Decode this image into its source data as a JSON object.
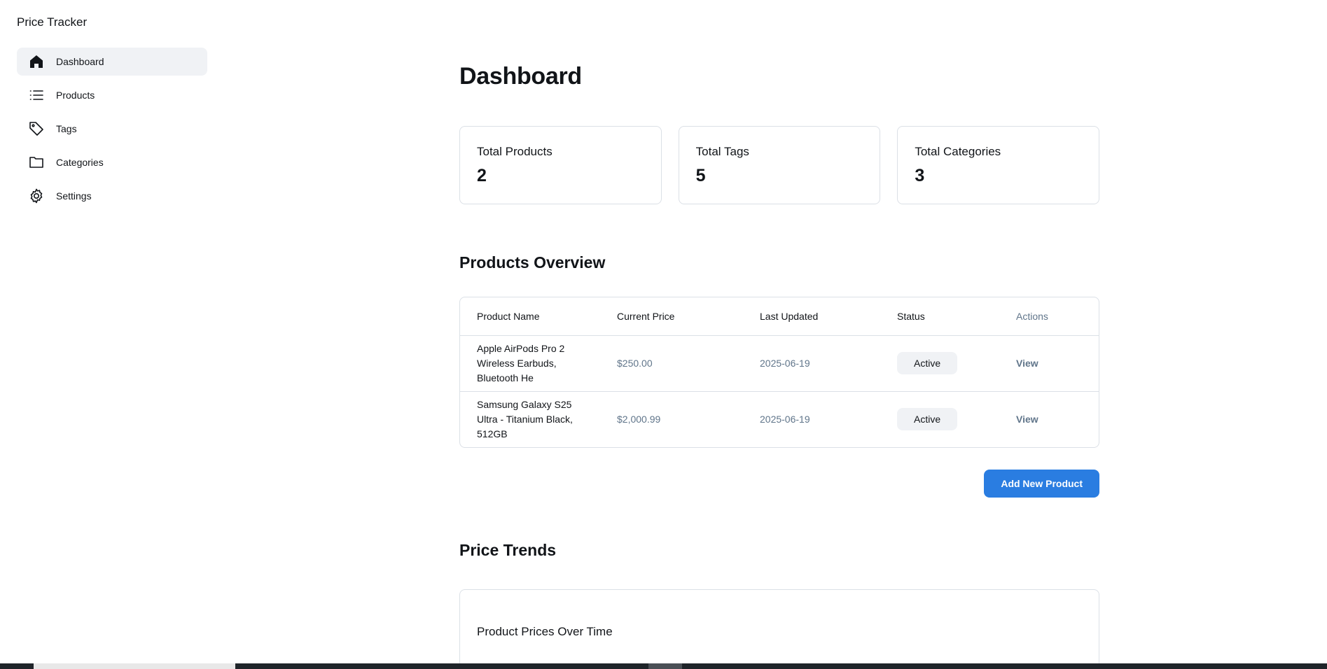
{
  "app": {
    "title": "Price Tracker"
  },
  "sidebar": {
    "items": [
      {
        "label": "Dashboard",
        "icon": "house-icon",
        "active": true
      },
      {
        "label": "Products",
        "icon": "list-icon",
        "active": false
      },
      {
        "label": "Tags",
        "icon": "tag-icon",
        "active": false
      },
      {
        "label": "Categories",
        "icon": "folder-icon",
        "active": false
      },
      {
        "label": "Settings",
        "icon": "gear-icon",
        "active": false
      }
    ]
  },
  "main": {
    "title": "Dashboard",
    "stats": [
      {
        "label": "Total Products",
        "value": "2"
      },
      {
        "label": "Total Tags",
        "value": "5"
      },
      {
        "label": "Total Categories",
        "value": "3"
      }
    ],
    "products_overview": {
      "title": "Products Overview",
      "columns": [
        "Product Name",
        "Current Price",
        "Last Updated",
        "Status",
        "Actions"
      ],
      "rows": [
        {
          "name": "Apple AirPods Pro 2 Wireless Earbuds, Bluetooth He",
          "price": "$250.00",
          "updated": "2025-06-19",
          "status": "Active",
          "action": "View"
        },
        {
          "name": "Samsung Galaxy S25 Ultra - Titanium Black, 512GB",
          "price": "$2,000.99",
          "updated": "2025-06-19",
          "status": "Active",
          "action": "View"
        }
      ],
      "add_button": "Add New Product"
    },
    "price_trends": {
      "title": "Price Trends",
      "card_title": "Product Prices Over Time"
    }
  },
  "colors": {
    "accent": "#2a7de1",
    "muted_text": "#60758a",
    "border": "#dbe0e6",
    "active_bg": "#f0f2f5"
  }
}
